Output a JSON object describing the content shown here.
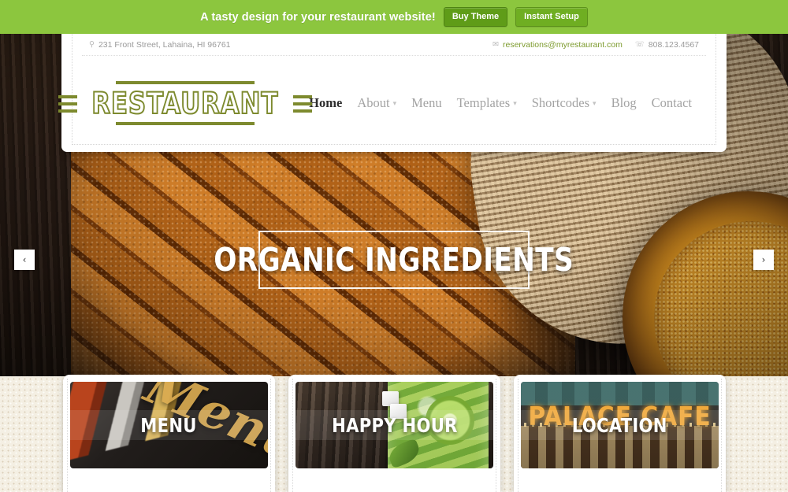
{
  "promo_bar": {
    "message": "A tasty design for your restaurant website!",
    "buy_theme_label": "Buy Theme",
    "instant_setup_label": "Instant Setup",
    "background_color": "#8cc63e"
  },
  "header": {
    "contact": {
      "address_icon": "map-pin-icon",
      "address": "231 Front Street, Lahaina, HI 96761",
      "email_icon": "envelope-icon",
      "email": "reservations@myrestaurant.com",
      "email_color": "#7d9b2e",
      "phone_icon": "phone-icon",
      "phone": "808.123.4567"
    },
    "logo": {
      "text": "RESTAURANT",
      "color": "#7d8a2e"
    },
    "nav": [
      {
        "label": "Home",
        "active": true,
        "has_dropdown": false
      },
      {
        "label": "About",
        "active": false,
        "has_dropdown": true
      },
      {
        "label": "Menu",
        "active": false,
        "has_dropdown": false
      },
      {
        "label": "Templates",
        "active": false,
        "has_dropdown": true
      },
      {
        "label": "Shortcodes",
        "active": false,
        "has_dropdown": true
      },
      {
        "label": "Blog",
        "active": false,
        "has_dropdown": false
      },
      {
        "label": "Contact",
        "active": false,
        "has_dropdown": false
      }
    ],
    "nav_caret": "▾"
  },
  "hero": {
    "title": "ORGANIC INGREDIENTS",
    "prev_arrow": "‹",
    "next_arrow": "›"
  },
  "features": [
    {
      "label": "MENU",
      "script_overlay": "Menu"
    },
    {
      "label": "HAPPY HOUR",
      "script_overlay": ""
    },
    {
      "label": "LOCATION",
      "marquee_sign": "PALACE CAFE"
    }
  ]
}
